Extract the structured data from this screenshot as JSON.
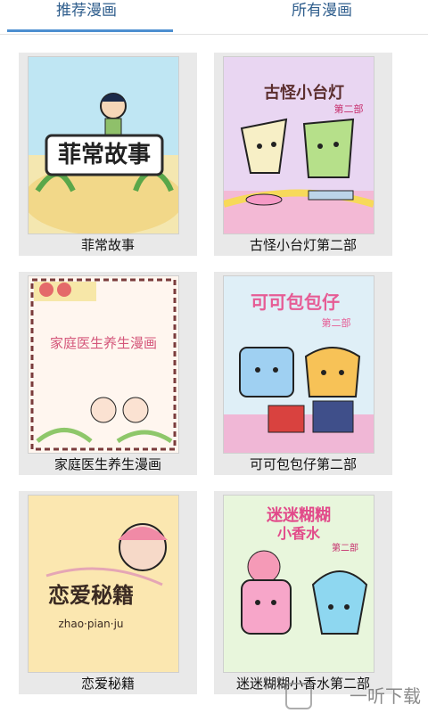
{
  "tabs": [
    {
      "label": "推荐漫画",
      "active": true
    },
    {
      "label": "所有漫画",
      "active": false
    }
  ],
  "colors": {
    "tab_text": "#2e5d8c",
    "tab_indicator": "#4d8fd0",
    "card_bg": "#e9e9e9"
  },
  "comics": [
    {
      "title": "菲常故事",
      "cover_text": "菲常故事",
      "cover_bg": "#f4e7b0"
    },
    {
      "title": "古怪小台灯第二部",
      "cover_text": "古怪小台灯",
      "cover_sub": "第二部",
      "cover_bg": "#e9d6f2"
    },
    {
      "title": "家庭医生养生漫画",
      "cover_text": "家庭医生养生漫画",
      "cover_bg": "#fff6ef"
    },
    {
      "title": "可可包包仔第二部",
      "cover_text": "可可包包仔",
      "cover_sub": "第二部",
      "cover_bg": "#dfeff7"
    },
    {
      "title": "恋爱秘籍",
      "cover_text": "恋爱秘籍",
      "cover_sub": "zhao·pian·ju",
      "cover_bg": "#fbe7b0"
    },
    {
      "title": "迷迷糊糊小香水第二部",
      "cover_text": "迷迷糊糊",
      "cover_text2": "小香水",
      "cover_sub": "第二部",
      "cover_bg": "#e8f6dc"
    }
  ],
  "watermark": "一听下载"
}
